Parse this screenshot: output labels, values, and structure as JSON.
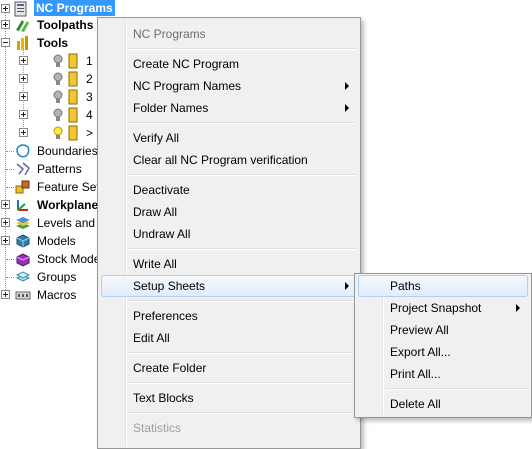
{
  "tree": {
    "items": [
      {
        "label": "NC Programs",
        "bold": true,
        "selected": true,
        "icon": "nc-programs-icon"
      },
      {
        "label": "Toolpaths",
        "bold": true,
        "icon": "toolpaths-icon"
      },
      {
        "label": "Tools",
        "bold": true,
        "icon": "tools-icon"
      },
      {
        "label": "1",
        "icon": "tool-icon"
      },
      {
        "label": "2",
        "icon": "tool-icon"
      },
      {
        "label": "3",
        "icon": "tool-icon"
      },
      {
        "label": "4",
        "icon": "tool-icon"
      },
      {
        "label": ">",
        "icon": "tool-active-icon"
      },
      {
        "label": "Boundaries",
        "icon": "boundaries-icon"
      },
      {
        "label": "Patterns",
        "icon": "patterns-icon"
      },
      {
        "label": "Feature Sets",
        "icon": "feature-sets-icon"
      },
      {
        "label": "Workplanes",
        "bold": true,
        "icon": "workplanes-icon"
      },
      {
        "label": "Levels and S",
        "icon": "levels-icon"
      },
      {
        "label": "Models",
        "icon": "models-icon"
      },
      {
        "label": "Stock Mode",
        "icon": "stock-model-icon"
      },
      {
        "label": "Groups",
        "icon": "groups-icon"
      },
      {
        "label": "Macros",
        "icon": "macros-icon"
      }
    ]
  },
  "context_menu": {
    "header": "NC Programs",
    "items": {
      "create_nc_program": "Create NC Program",
      "nc_program_names": "NC Program Names",
      "folder_names": "Folder Names",
      "verify_all": "Verify All",
      "clear_verification": "Clear all NC Program verification",
      "deactivate": "Deactivate",
      "draw_all": "Draw All",
      "undraw_all": "Undraw All",
      "write_all": "Write All",
      "setup_sheets": "Setup Sheets",
      "preferences": "Preferences",
      "edit_all": "Edit All",
      "create_folder": "Create Folder",
      "text_blocks": "Text Blocks",
      "statistics": "Statistics"
    }
  },
  "submenu": {
    "items": {
      "paths": "Paths",
      "project_snapshot": "Project Snapshot",
      "preview_all": "Preview All",
      "export_all": "Export All...",
      "print_all": "Print All...",
      "delete_all": "Delete All"
    }
  },
  "colors": {
    "selection": "#3399ff",
    "menu_background": "#f0f0f0",
    "highlight_border": "#aecff7"
  }
}
